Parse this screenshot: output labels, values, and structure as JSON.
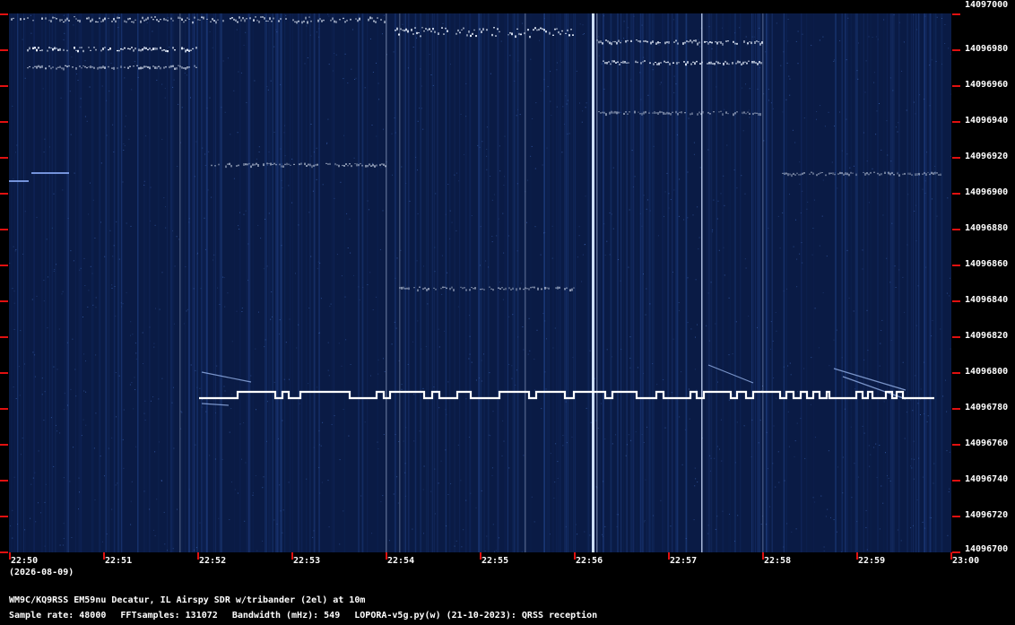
{
  "waterfall": {
    "freq_axis": [
      "14097000",
      "14096980",
      "14096960",
      "14096940",
      "14096920",
      "14096900",
      "14096880",
      "14096860",
      "14096840",
      "14096820",
      "14096800",
      "14096780",
      "14096760",
      "14096740",
      "14096720",
      "14096700"
    ],
    "time_axis": [
      "22:50",
      "22:51",
      "22:52",
      "22:53",
      "22:54",
      "22:55",
      "22:56",
      "22:57",
      "22:58",
      "22:59",
      "23:00"
    ],
    "date": "(2026-08-09)",
    "colors": {
      "background": "#0a1b45",
      "signal": "#ffffff",
      "tick": "#e01010"
    }
  },
  "footer": {
    "station": "WM9C/KQ9RSS EM59nu Decatur, IL  Airspy SDR w/tribander (2el) at 10m",
    "sample_rate": "Sample rate: 48000",
    "fft_samples": "FFTsamples: 131072",
    "bandwidth": "Bandwidth (mHz): 549",
    "software": "LOPORA-v5g.py(w) (21-10-2023): QRSS reception"
  }
}
